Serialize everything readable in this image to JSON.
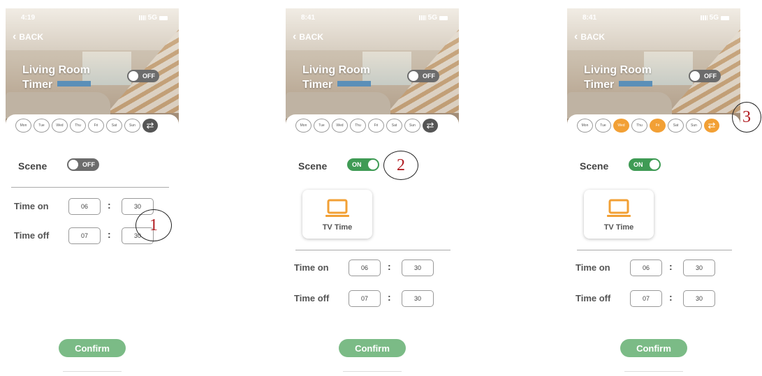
{
  "screens": [
    {
      "status_time": "4:19",
      "network": "5G",
      "back": "BACK",
      "title": "Living Room Timer",
      "master_toggle": "OFF",
      "days": [
        "Mon",
        "Tue",
        "Wed",
        "Thu",
        "Fri",
        "Sat",
        "Sun"
      ],
      "selected_days": [],
      "repeat_on": false,
      "scene_label": "Scene",
      "scene_toggle": "OFF",
      "time_on_label": "Time on",
      "time_on": {
        "h": "06",
        "m": "30"
      },
      "time_off_label": "Time off",
      "time_off": {
        "h": "07",
        "m": "30"
      },
      "confirm": "Confirm",
      "callout": "1"
    },
    {
      "status_time": "8:41",
      "network": "5G",
      "back": "BACK",
      "title": "Living Room Timer",
      "master_toggle": "OFF",
      "days": [
        "Mon",
        "Tue",
        "Wed",
        "Thu",
        "Fri",
        "Sat",
        "Sun"
      ],
      "selected_days": [],
      "repeat_on": false,
      "scene_label": "Scene",
      "scene_toggle": "ON",
      "scene_item": "TV Time",
      "time_on_label": "Time on",
      "time_on": {
        "h": "06",
        "m": "30"
      },
      "time_off_label": "Time off",
      "time_off": {
        "h": "07",
        "m": "30"
      },
      "confirm": "Confirm",
      "callout": "2"
    },
    {
      "status_time": "8:41",
      "network": "5G",
      "back": "BACK",
      "title": "Living Room Timer",
      "master_toggle": "OFF",
      "days": [
        "Mon",
        "Tue",
        "Wed",
        "Thu",
        "Fri",
        "Sat",
        "Sun"
      ],
      "selected_days": [
        "Wed",
        "Fri"
      ],
      "repeat_on": true,
      "scene_label": "Scene",
      "scene_toggle": "ON",
      "scene_item": "TV Time",
      "time_on_label": "Time on",
      "time_on": {
        "h": "06",
        "m": "30"
      },
      "time_off_label": "Time off",
      "time_off": {
        "h": "07",
        "m": "30"
      },
      "confirm": "Confirm",
      "callout": "3"
    }
  ],
  "colors": {
    "accent_green": "#3f9b55",
    "confirm_green": "#7bbb86",
    "accent_orange": "#f2a035",
    "callout_red": "#b11d22"
  },
  "icons": {
    "back": "chevron-left-icon",
    "repeat": "repeat-icon",
    "tv": "laptop-tv-icon"
  }
}
